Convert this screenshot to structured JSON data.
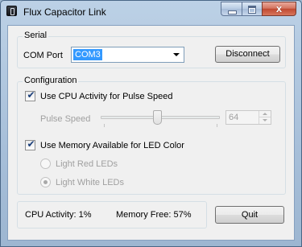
{
  "window": {
    "title": "Flux Capacitor Link",
    "icon": "flux-capacitor-app-icon",
    "close_glyph": "x"
  },
  "serial": {
    "legend": "Serial",
    "com_port_label": "COM Port",
    "com_port_value": "COM3",
    "disconnect_label": "Disconnect"
  },
  "configuration": {
    "legend": "Configuration",
    "cpu_checkbox_label": "Use CPU Activity for Pulse Speed",
    "cpu_checked": true,
    "pulse_speed_label": "Pulse Speed",
    "pulse_speed_value": "64",
    "memory_checkbox_label": "Use Memory Available for LED Color",
    "memory_checked": true,
    "radio_red_label": "Light Red LEDs",
    "radio_white_label": "Light White LEDs",
    "selected_radio": "Light White LEDs"
  },
  "status": {
    "cpu_activity": "CPU Activity: 1%",
    "memory_free": "Memory Free: 57%",
    "quit_label": "Quit"
  },
  "check_glyph": "✔"
}
